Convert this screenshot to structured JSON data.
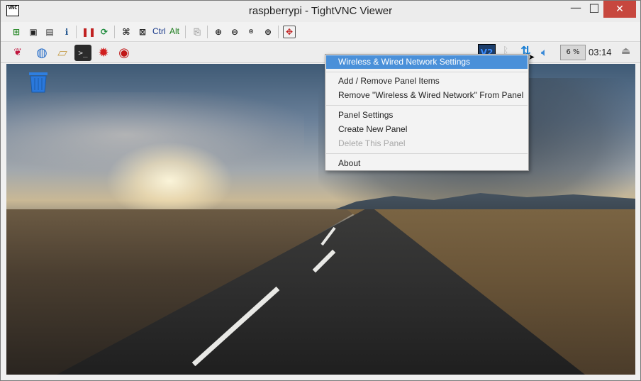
{
  "window": {
    "title": "raspberrypi - TightVNC Viewer",
    "app_icon_text": "VNC",
    "minimize": "—",
    "maximize": "□",
    "close": "✕"
  },
  "toolbar": {
    "ctrl_label": "Ctrl",
    "alt_label": "Alt"
  },
  "panel": {
    "vnc_badge": "V2",
    "cpu_usage": "6 %",
    "clock": "03:14"
  },
  "context_menu": {
    "items": [
      {
        "label": "Wireless & Wired Network Settings",
        "state": "highlighted"
      },
      {
        "label": "Add / Remove Panel Items",
        "state": "normal"
      },
      {
        "label": "Remove \"Wireless & Wired Network\" From Panel",
        "state": "normal"
      },
      {
        "label": "Panel Settings",
        "state": "normal"
      },
      {
        "label": "Create New Panel",
        "state": "normal"
      },
      {
        "label": "Delete This Panel",
        "state": "disabled"
      },
      {
        "label": "About",
        "state": "normal"
      }
    ]
  },
  "colors": {
    "menu_highlight": "#4a90d9",
    "close_button": "#c7473e",
    "network_icon": "#1a7fd4"
  }
}
